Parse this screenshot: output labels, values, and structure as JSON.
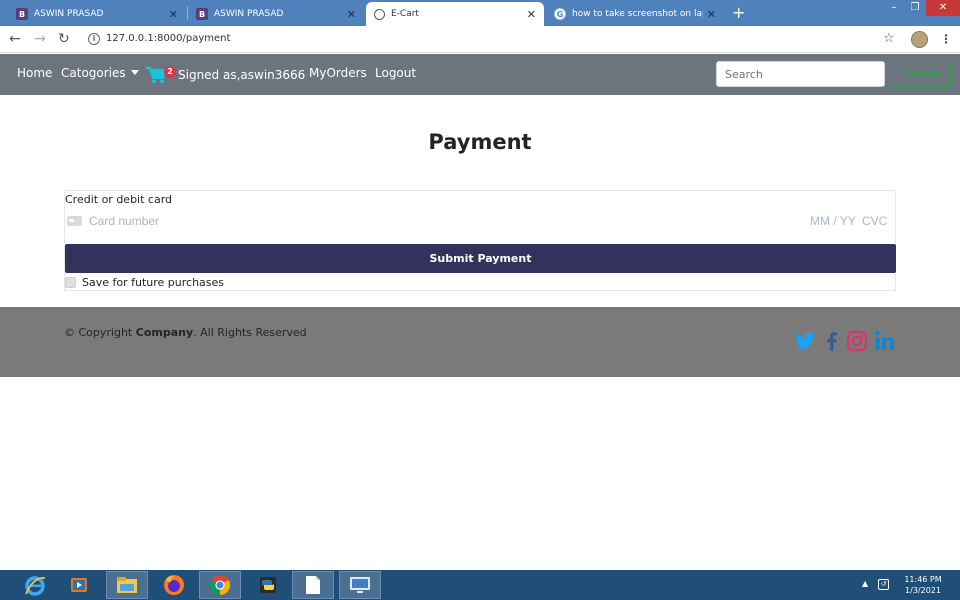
{
  "browser": {
    "tabs": [
      {
        "title": "ASWIN PRASAD",
        "favicon": "bootstrap-icon",
        "active": false
      },
      {
        "title": "ASWIN PRASAD",
        "favicon": "bootstrap-icon",
        "active": false
      },
      {
        "title": "E-Cart",
        "favicon": "globe-icon",
        "active": true
      },
      {
        "title": "how to take screenshot on laptop",
        "favicon": "google-icon",
        "active": false
      }
    ],
    "url": "127.0.0.1:8000/payment"
  },
  "navbar": {
    "home": "Home",
    "categories": "Catogories",
    "cart_count": "2",
    "signed_in": "Signed as,aswin3666",
    "my_orders": "MyOrders",
    "logout": "Logout",
    "search_placeholder": "Search",
    "search_button": "Search"
  },
  "main": {
    "title": "Payment",
    "card_label": "Credit or debit card",
    "card_number_placeholder": "Card number",
    "expiry_placeholder": "MM / YY",
    "cvc_placeholder": "CVC",
    "submit_label": "Submit Payment",
    "save_label": "Save for future purchases"
  },
  "footer": {
    "copyright_prefix": "© Copyright",
    "company": "Company",
    "copyright_suffix": ". All Rights Reserved",
    "social": [
      "twitter-icon",
      "facebook-icon",
      "instagram-icon",
      "linkedin-icon"
    ]
  },
  "taskbar": {
    "time": "11:46 PM",
    "date": "1/3/2021"
  },
  "colors": {
    "navbar_bg": "#6c757d",
    "submit_bg": "#32325d",
    "footer_bg": "#7a7a7a",
    "search_green": "#28a745"
  }
}
